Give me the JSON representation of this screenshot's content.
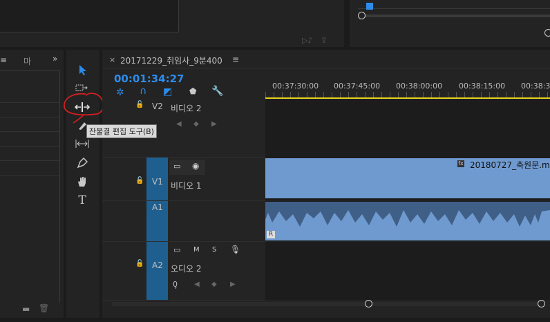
{
  "project_panel": {
    "tab_partial": "마",
    "tab_menu_icon": "≡",
    "expand_icon": "»"
  },
  "tools": {
    "tooltip": "잔물결 편집 도구(B)"
  },
  "timeline": {
    "sequence_name": "20171229_취임사_9분400",
    "timecode": "00:01:34:27",
    "ruler": [
      "00:37:30:00",
      "00:37:45:00",
      "00:38:00:00",
      "00:38:15:00",
      "00:38:3"
    ],
    "tracks": {
      "v2": {
        "id": "V2",
        "name": "비디오 2"
      },
      "v1": {
        "id": "V1",
        "name": "비디오 1"
      },
      "a1": {
        "id": "A1"
      },
      "a2": {
        "id": "A2",
        "name": "오디오 2",
        "m": "M",
        "s": "S"
      }
    },
    "clips": {
      "video_clip_name": "20180727_축원문.m",
      "audio_badge": "R"
    },
    "colors": {
      "accent": "#2d8ceb",
      "clip": "#6f9ad0",
      "track_tab": "#1f5f8f",
      "annotation": "#d21f1f"
    }
  }
}
